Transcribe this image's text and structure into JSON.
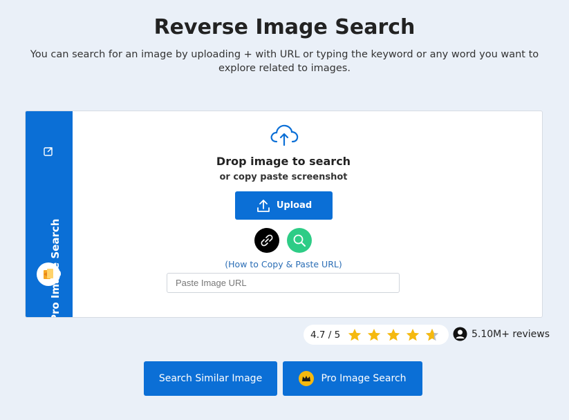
{
  "header": {
    "title": "Reverse Image Search",
    "subtitle": "You can search for an image by uploading + with URL or typing the keyword or any word you want to explore related to images."
  },
  "sidebar": {
    "label": "Pro Image Search",
    "icons": [
      "external-link-icon",
      "user-avatar-icon"
    ]
  },
  "upload_area": {
    "icon": "cloud-upload-icon",
    "title": "Drop image to search",
    "subtitle": "or copy paste screenshot",
    "upload_label": "Upload",
    "link_icon": "link-icon",
    "search_icon": "search-icon",
    "howto_text": "(How to Copy & Paste URL)",
    "url_placeholder": "Paste Image URL",
    "url_value": ""
  },
  "rating": {
    "score_text": "4.7 / 5",
    "stars": 4.7,
    "reviews_text": "5.10M+ reviews"
  },
  "actions": {
    "similar_label": "Search Similar Image",
    "pro_label": "Pro Image Search"
  },
  "colors": {
    "accent": "#0b6fd6",
    "search_button": "#2ecc86",
    "star": "#f5b90f",
    "background": "#eaf0f8"
  }
}
